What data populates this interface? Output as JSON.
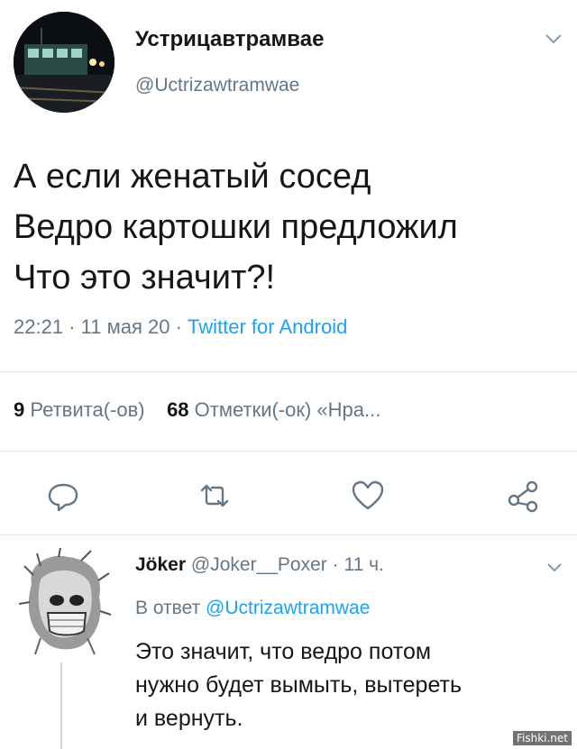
{
  "tweet": {
    "display_name": "Устрицавтрамвае",
    "handle": "@Uctrizawtramwae",
    "text": "А если женатый сосед\nВедро картошки предложил\nЧто это значит?!",
    "time": "22:21",
    "date": "11 мая 20",
    "source": "Twitter for Android",
    "retweets_count": "9",
    "retweets_label": "Ретвита(-ов)",
    "likes_count": "68",
    "likes_label": "Отметки(-ок) «Нра..."
  },
  "actions": [
    "reply-icon",
    "retweet-icon",
    "like-icon",
    "share-icon"
  ],
  "reply": {
    "display_name": "Jöker",
    "handle": "@Joker__Poxer",
    "age": "11 ч.",
    "reply_to_prefix": "В ответ",
    "reply_to_handle": "@Uctrizawtramwae",
    "text": "Это значит, что ведро потом\nнужно будет вымыть, вытереть\nи вернуть."
  },
  "watermark": "Fishki.net",
  "colors": {
    "text": "#14171a",
    "secondary": "#657786",
    "link": "#1da1f2",
    "divider": "#e1e8ed"
  }
}
